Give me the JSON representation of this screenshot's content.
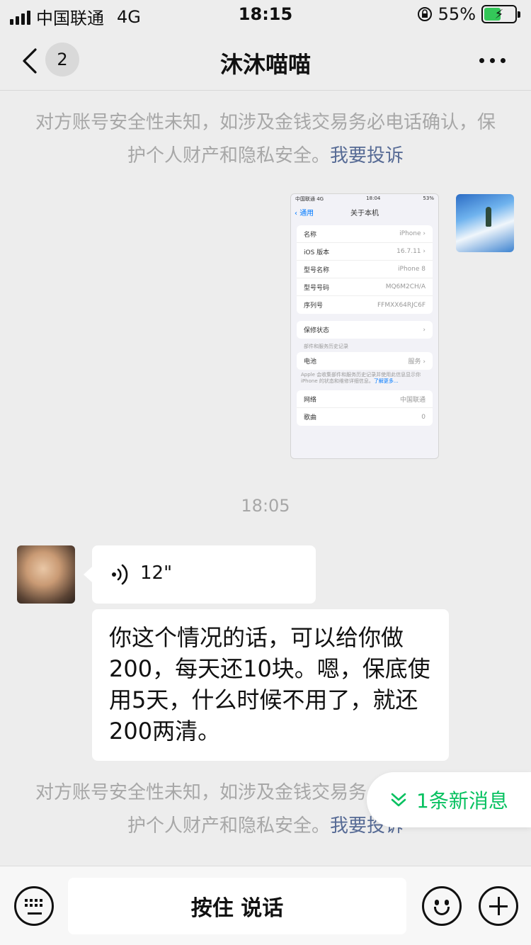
{
  "status_bar": {
    "carrier": "中国联通",
    "network": "4G",
    "time": "18:15",
    "battery": "55%",
    "battery_level": 0.55
  },
  "header": {
    "badge_count": "2",
    "title": "沐沐喵喵"
  },
  "notice": {
    "text": "对方账号安全性未知，如涉及金钱交易务必电话确认，保护个人财产和隐私安全。",
    "link": "我要投诉"
  },
  "screenshot_message": {
    "status": {
      "carrier": "中国联通 4G",
      "time": "18:04",
      "battery": "53%"
    },
    "back_label": "通用",
    "title": "关于本机",
    "group1": [
      {
        "label": "名称",
        "value": "iPhone"
      },
      {
        "label": "iOS 版本",
        "value": "16.7.11"
      },
      {
        "label": "型号名称",
        "value": "iPhone 8"
      },
      {
        "label": "型号号码",
        "value": "MQ6M2CH/A"
      },
      {
        "label": "序列号",
        "value": "FFMXX64RJC6F"
      }
    ],
    "warranty": "保修状态",
    "history_caption": "部件和服务历史记录",
    "battery_row": {
      "label": "电池",
      "value": "服务"
    },
    "footnote": "Apple 会收集部件和服务历史记录并使用此信息显示你 iPhone 的状态和维修详细信息。",
    "footnote_link": "了解更多...",
    "group3": [
      {
        "label": "网络",
        "value": "中国联通"
      },
      {
        "label": "歌曲",
        "value": "0"
      }
    ]
  },
  "timestamp": "18:05",
  "voice_message": {
    "duration": "12\""
  },
  "text_message": "你这个情况的话，可以给你做200，每天还10块。嗯，保底使用5天，什么时候不用了，就还200两清。",
  "new_messages": "1条新消息",
  "input_bar": {
    "hold_to_talk": "按住 说话"
  },
  "icons": [
    "back-icon",
    "more-icon",
    "voice-wave-icon",
    "double-chevron-down-icon",
    "keyboard-icon",
    "emoji-icon",
    "plus-icon"
  ],
  "colors": {
    "link": "#576b95",
    "accent_green": "#07c160",
    "background": "#ededed"
  }
}
